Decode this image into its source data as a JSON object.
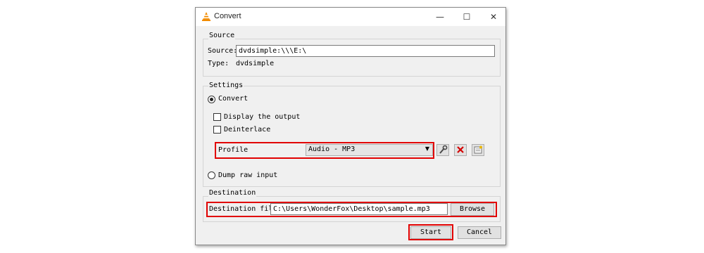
{
  "window": {
    "title": "Convert",
    "minimize_glyph": "—",
    "maximize_glyph": "☐",
    "close_glyph": "✕"
  },
  "source": {
    "group_title": "Source",
    "source_label": "Source:",
    "source_value": "dvdsimple:\\\\\\E:\\",
    "type_label": "Type:",
    "type_value": "dvdsimple"
  },
  "settings": {
    "group_title": "Settings",
    "convert_label": "Convert",
    "display_output_label": "Display the output",
    "deinterlace_label": "Deinterlace",
    "profile_label": "Profile",
    "profile_selected": "Audio - MP3",
    "dump_raw_label": "Dump raw input",
    "convert_selected": true,
    "display_output_checked": false,
    "deinterlace_checked": false
  },
  "destination": {
    "group_title": "Destination",
    "file_label": "Destination file:",
    "file_value": "C:\\Users\\WonderFox\\Desktop\\sample.mp3",
    "browse_label": "Browse"
  },
  "buttons": {
    "start_label": "Start",
    "cancel_label": "Cancel"
  },
  "colors": {
    "highlight": "#e10000",
    "delete_icon": "#d40000",
    "vlc_orange": "#f28c00"
  },
  "icons": [
    "vlc-cone-icon",
    "wrench-icon",
    "delete-x-icon",
    "new-profile-icon",
    "dropdown-arrow-icon"
  ]
}
